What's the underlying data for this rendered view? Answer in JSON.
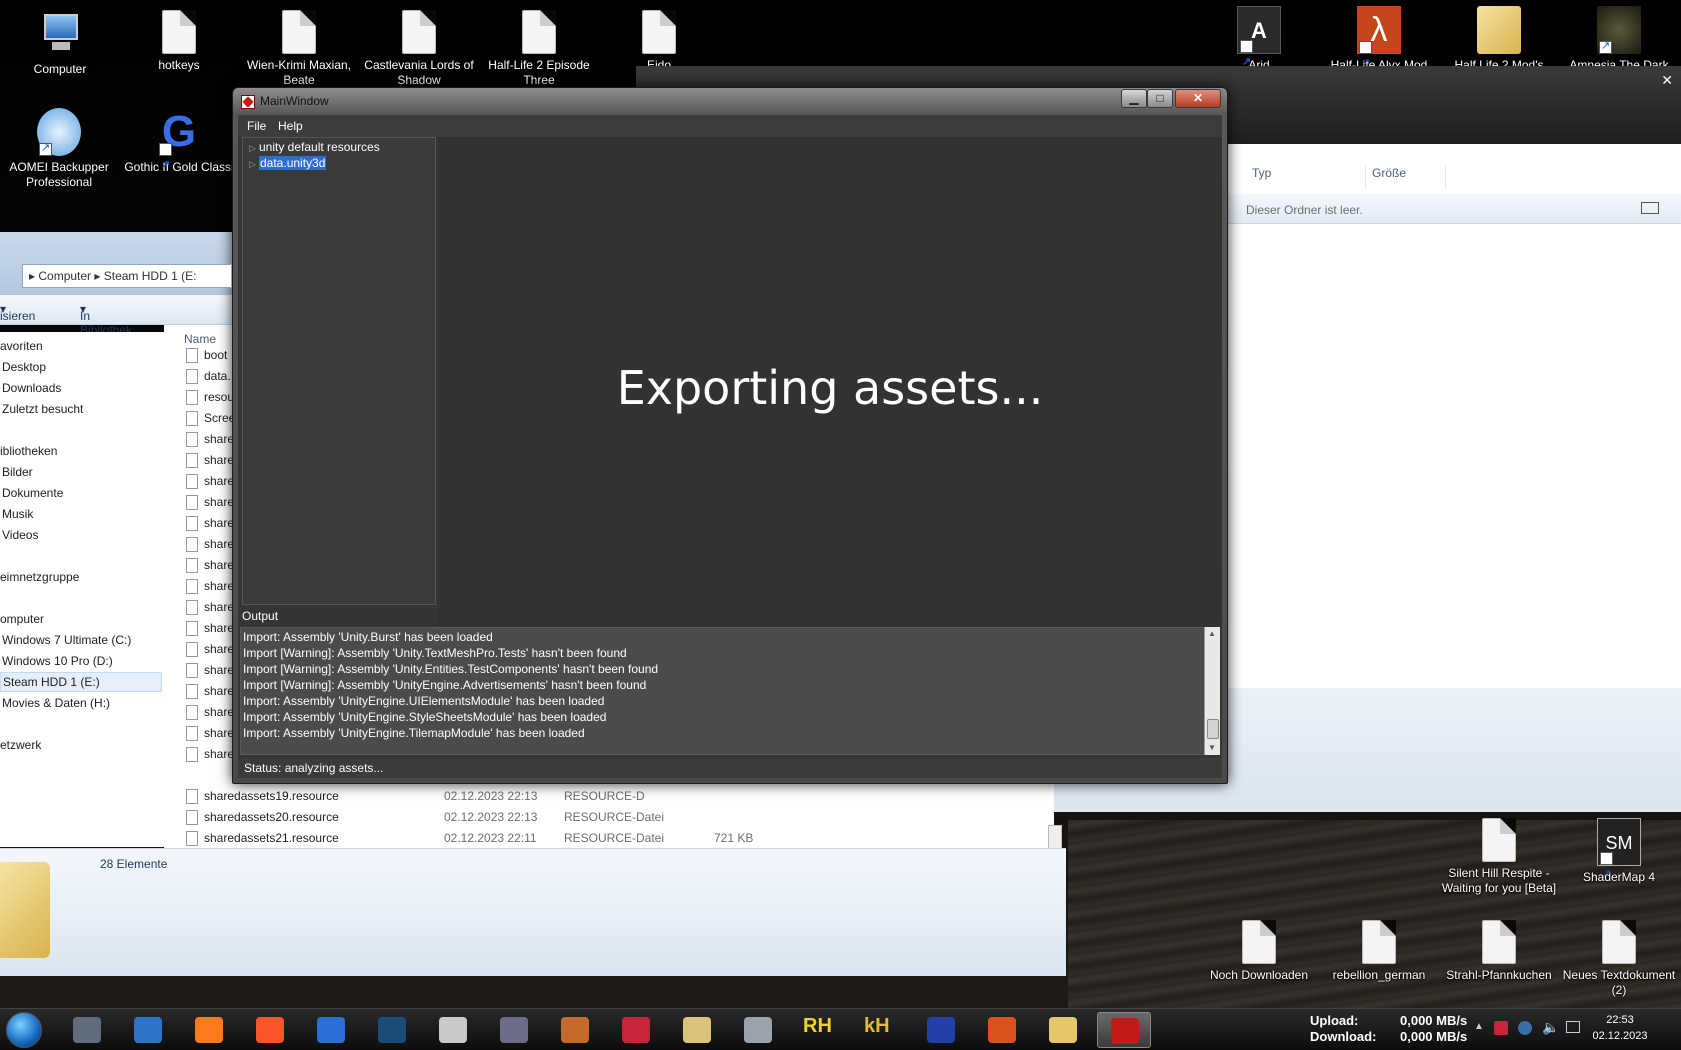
{
  "desktop": {
    "top_icons": [
      {
        "label": "Computer"
      },
      {
        "label": "hotkeys"
      },
      {
        "label": "Wien-Krimi Maxian, Beate"
      },
      {
        "label": "Castlevania Lords of Shadow"
      },
      {
        "label": "Half-Life 2 Episode Three"
      },
      {
        "label": "Eido"
      },
      {
        "label": "Arid"
      },
      {
        "label": "Half-Life Alyx Mod"
      },
      {
        "label": "Half Life 2 Mod's"
      },
      {
        "label": "Amnesia The Dark"
      }
    ],
    "left_icons": [
      {
        "label": "AOMEI Backupper Professional"
      },
      {
        "label": "Gothic II Gold Classi"
      }
    ],
    "bottom_right_icons": [
      {
        "label": "Silent Hill Respite - Waiting for you [Beta]"
      },
      {
        "label": "ShaderMap 4"
      },
      {
        "label": "Noch Downloaden"
      },
      {
        "label": "rebellion_german"
      },
      {
        "label": "Strahl-Pfannkuchen"
      },
      {
        "label": "Neues Textdokument (2)"
      }
    ]
  },
  "right_explorer": {
    "columns": [
      "Typ",
      "Größe"
    ],
    "empty_message": "Dieser Ordner ist leer."
  },
  "left_explorer": {
    "breadcrumb": [
      "Computer",
      "Steam HDD 1 (E:"
    ],
    "toolbar": {
      "organize": "isieren",
      "library": "In Bibliothek aufnehmen"
    },
    "nav": [
      "avoriten",
      "Desktop",
      "Downloads",
      "Zuletzt besucht",
      "ibliotheken",
      "Bilder",
      "Dokumente",
      "Musik",
      "Videos",
      "eimnetzgruppe",
      "omputer",
      "Windows 7 Ultimate (C:)",
      "Windows 10 Pro (D:)",
      "Steam HDD 1 (E:)",
      "Movies & Daten (H:)",
      "etzwerk"
    ],
    "name_header": "Name",
    "partial_files": [
      "boot",
      "data.",
      "resou",
      "Scree",
      "share",
      "share",
      "share",
      "share",
      "share",
      "share",
      "share",
      "share",
      "share",
      "share",
      "share",
      "share",
      "share",
      "share",
      "share",
      "share"
    ],
    "full_files": [
      {
        "name": "sharedassets19.resource",
        "date": "02.12.2023 22:13",
        "type": "RESOURCE-D",
        "size": ""
      },
      {
        "name": "sharedassets20.resource",
        "date": "02.12.2023 22:13",
        "type": "RESOURCE-Datei",
        "size": ""
      },
      {
        "name": "sharedassets21.resource",
        "date": "02.12.2023 22:11",
        "type": "RESOURCE-Datei",
        "size": "721 KB"
      }
    ],
    "item_count": "28 Elemente"
  },
  "main_window": {
    "title": "MainWindow",
    "menu": [
      "File",
      "Help"
    ],
    "tree": [
      {
        "label": "unity default resources",
        "selected": false
      },
      {
        "label": "data.unity3d",
        "selected": true
      }
    ],
    "progress_message": "Exporting assets...",
    "output_label": "Output",
    "log": [
      "Import: Assembly 'Unity.Burst' has been loaded",
      "Import [Warning]: Assembly 'Unity.TextMeshPro.Tests' hasn't been found",
      "Import [Warning]: Assembly 'Unity.Entities.TestComponents' hasn't been found",
      "Import [Warning]: Assembly 'UnityEngine.Advertisements' hasn't been found",
      "Import: Assembly 'UnityEngine.UIElementsModule' has been loaded",
      "Import: Assembly 'UnityEngine.StyleSheetsModule' has been loaded",
      "Import: Assembly 'UnityEngine.TilemapModule' has been loaded"
    ],
    "status": "Status: analyzing assets..."
  },
  "taskbar": {
    "apps": [
      {
        "icon": "ssd-icon",
        "color": "#5f6d7a"
      },
      {
        "icon": "id-icon",
        "color": "#2c74c7"
      },
      {
        "icon": "firefox-icon",
        "color": "#ff7a1a"
      },
      {
        "icon": "brave-icon",
        "color": "#fb542b"
      },
      {
        "icon": "thunderbird-icon",
        "color": "#2a6fd6"
      },
      {
        "icon": "steam-icon",
        "color": "#1b4c78"
      },
      {
        "icon": "document-icon",
        "color": "#c9c9c9"
      },
      {
        "icon": "flame-icon",
        "color": "#6d6d8a"
      },
      {
        "icon": "app-icon",
        "color": "#c56a2a"
      },
      {
        "icon": "flag-icon",
        "color": "#c8243a"
      },
      {
        "icon": "monitor-icon",
        "color": "#d9c37a"
      },
      {
        "icon": "tool-icon",
        "color": "#9aa3ab"
      },
      {
        "icon": "rh-icon",
        "color": "#f0d12a"
      },
      {
        "icon": "kh-icon",
        "color": "#e8b931"
      },
      {
        "icon": "globe-icon",
        "color": "#2340a8"
      },
      {
        "icon": "speaker-icon",
        "color": "#d9521f"
      },
      {
        "icon": "explorer-icon",
        "color": "#e5c66a"
      },
      {
        "icon": "unity-tool-icon",
        "color": "#c21919"
      }
    ],
    "rh_text": "RH",
    "kh_text": "kH",
    "upload_label": "Upload:",
    "download_label": "Download:",
    "upload_value": "0,000 MB/s",
    "download_value": "0,000 MB/s",
    "time": "22:53",
    "date": "02.12.2023"
  }
}
